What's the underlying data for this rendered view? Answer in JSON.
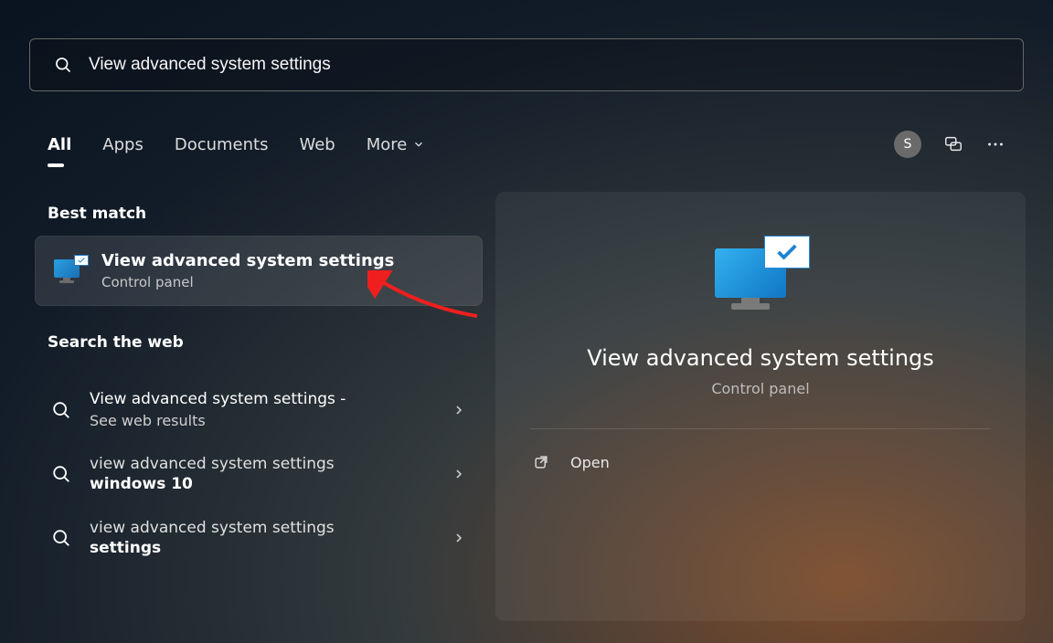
{
  "search": {
    "query": "View advanced system settings"
  },
  "filters": {
    "tabs": [
      "All",
      "Apps",
      "Documents",
      "Web",
      "More"
    ],
    "active_index": 0
  },
  "avatar_initial": "S",
  "sections": {
    "best_match_header": "Best match",
    "search_web_header": "Search the web"
  },
  "best_match": {
    "title": "View advanced system settings",
    "subtitle": "Control panel"
  },
  "web_results": [
    {
      "line1": "View advanced system settings -",
      "line2": "See web results",
      "bold": ""
    },
    {
      "line1": "view advanced system settings",
      "line2": "",
      "bold": "windows 10"
    },
    {
      "line1": "view advanced system settings",
      "line2": "",
      "bold": "settings"
    }
  ],
  "preview": {
    "title": "View advanced system settings",
    "subtitle": "Control panel",
    "open_label": "Open"
  }
}
